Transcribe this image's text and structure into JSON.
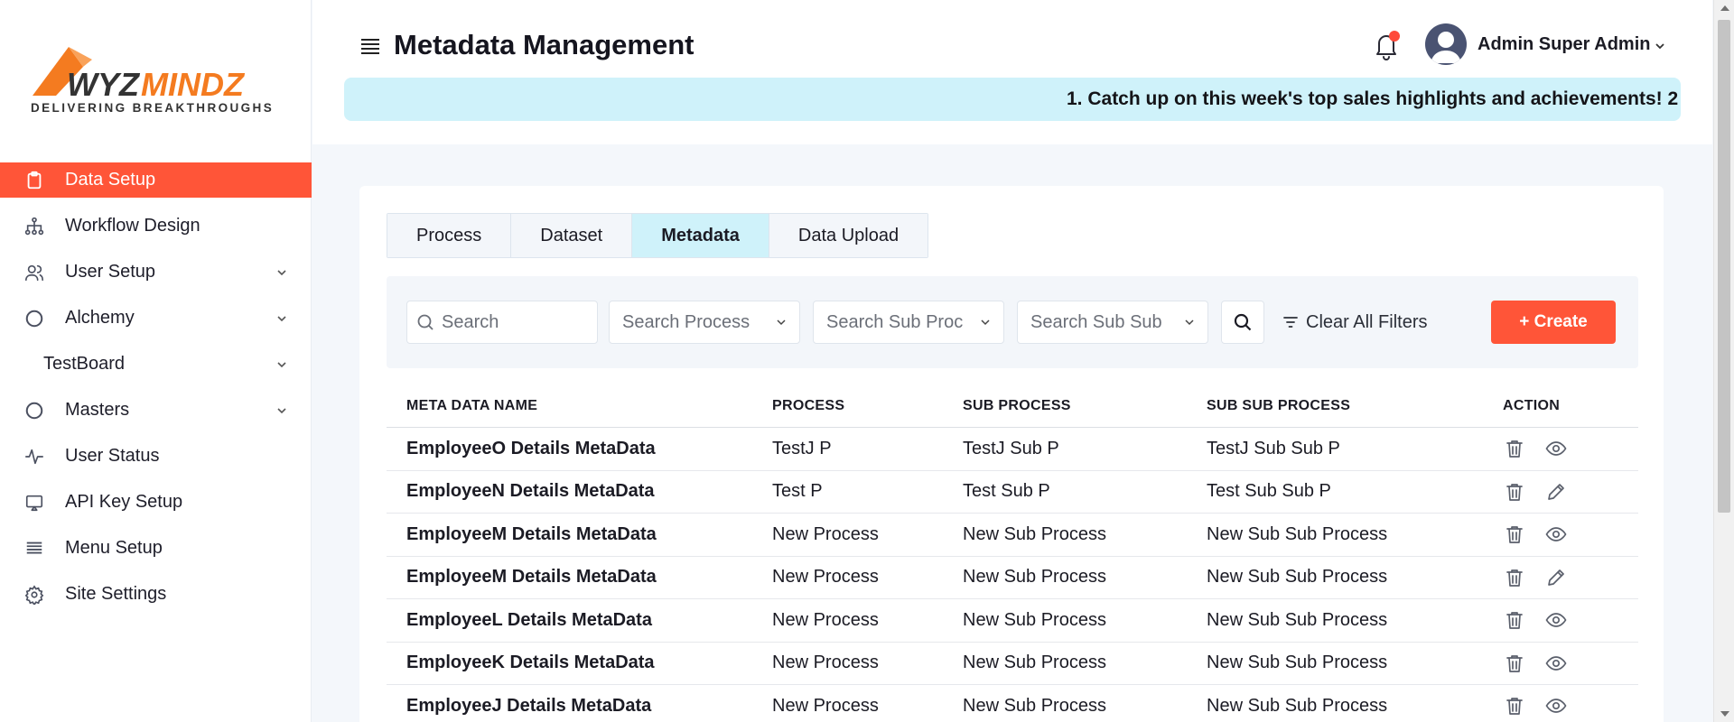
{
  "brand": {
    "name_part1": "WYZ",
    "name_part2": "MINDZ",
    "tagline": "DELIVERING BREAKTHROUGHS",
    "colors": {
      "orange": "#f47b20",
      "dark": "#333333"
    }
  },
  "sidebar": {
    "items": [
      {
        "label": "Data Setup",
        "icon": "clipboard-icon",
        "active": true,
        "has_chevron": false
      },
      {
        "label": "Workflow Design",
        "icon": "workflow-icon",
        "active": false,
        "has_chevron": false
      },
      {
        "label": "User Setup",
        "icon": "users-icon",
        "active": false,
        "has_chevron": true
      },
      {
        "label": "Alchemy",
        "icon": "circle-icon",
        "active": false,
        "has_chevron": true
      },
      {
        "label": "TestBoard",
        "icon": "",
        "active": false,
        "has_chevron": true
      },
      {
        "label": "Masters",
        "icon": "circle-icon",
        "active": false,
        "has_chevron": true
      },
      {
        "label": "User Status",
        "icon": "activity-icon",
        "active": false,
        "has_chevron": false
      },
      {
        "label": "API Key Setup",
        "icon": "monitor-icon",
        "active": false,
        "has_chevron": false
      },
      {
        "label": "Menu Setup",
        "icon": "menu-lines-icon",
        "active": false,
        "has_chevron": false
      },
      {
        "label": "Site Settings",
        "icon": "gear-icon",
        "active": false,
        "has_chevron": false
      }
    ]
  },
  "header": {
    "title": "Metadata Management",
    "user_name": "Admin Super Admin",
    "ticker": "1. Catch up on this week's top sales highlights and achievements! 2"
  },
  "tabs": [
    {
      "label": "Process",
      "active": false
    },
    {
      "label": "Dataset",
      "active": false
    },
    {
      "label": "Metadata",
      "active": true
    },
    {
      "label": "Data Upload",
      "active": false
    }
  ],
  "filters": {
    "search_placeholder": "Search",
    "process_placeholder": "Search Process",
    "sub_process_placeholder": "Search Sub Proc",
    "sub_sub_process_placeholder": "Search Sub Sub",
    "clear_label": "Clear All Filters",
    "create_label": "+ Create"
  },
  "table": {
    "columns": [
      "META DATA NAME",
      "PROCESS",
      "SUB PROCESS",
      "SUB SUB PROCESS",
      "ACTION"
    ],
    "rows": [
      {
        "name": "EmployeeO Details MetaData",
        "process": "TestJ P",
        "sub_process": "TestJ Sub P",
        "sub_sub_process": "TestJ Sub Sub P",
        "action2": "view"
      },
      {
        "name": "EmployeeN Details MetaData",
        "process": "Test P",
        "sub_process": "Test Sub P",
        "sub_sub_process": "Test Sub Sub P",
        "action2": "edit"
      },
      {
        "name": "EmployeeM Details MetaData",
        "process": "New Process",
        "sub_process": "New Sub Process",
        "sub_sub_process": "New Sub Sub Process",
        "action2": "view"
      },
      {
        "name": "EmployeeM Details MetaData",
        "process": "New Process",
        "sub_process": "New Sub Process",
        "sub_sub_process": "New Sub Sub Process",
        "action2": "edit"
      },
      {
        "name": "EmployeeL Details MetaData",
        "process": "New Process",
        "sub_process": "New Sub Process",
        "sub_sub_process": "New Sub Sub Process",
        "action2": "view"
      },
      {
        "name": "EmployeeK Details MetaData",
        "process": "New Process",
        "sub_process": "New Sub Process",
        "sub_sub_process": "New Sub Sub Process",
        "action2": "view"
      },
      {
        "name": "EmployeeJ Details MetaData",
        "process": "New Process",
        "sub_process": "New Sub Process",
        "sub_sub_process": "New Sub Sub Process",
        "action2": "view"
      }
    ]
  },
  "colors": {
    "accent": "#ff5538",
    "tab_active": "#cff2fa",
    "ticker_bg": "#cff2fa",
    "notification_dot": "#ff4a3a"
  }
}
